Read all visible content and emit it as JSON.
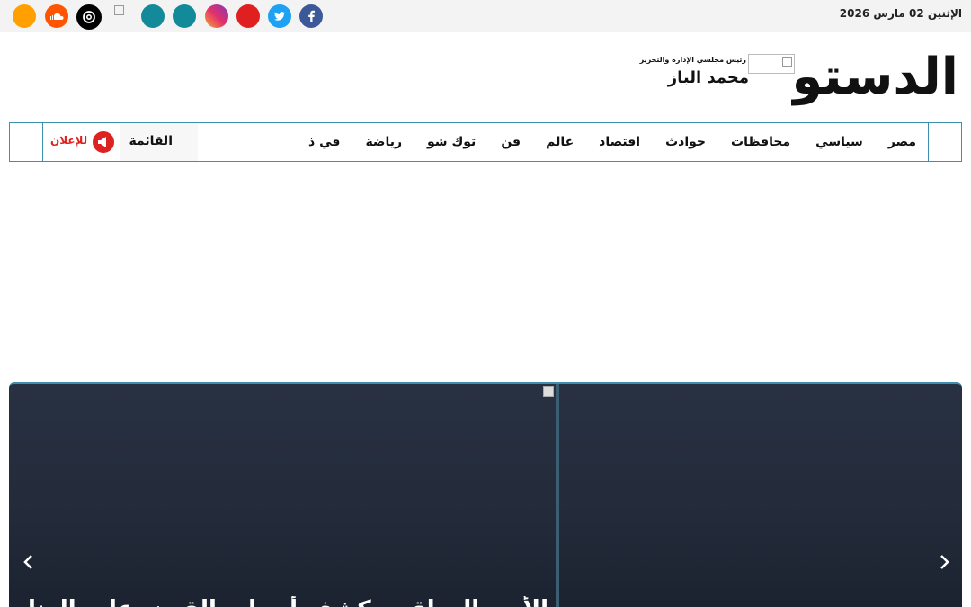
{
  "topbar": {
    "date": "الإثنين 02 مارس 2026",
    "social": [
      {
        "name": "facebook-icon",
        "color": "#3b5998"
      },
      {
        "name": "twitter-icon",
        "color": "#1da1f2"
      },
      {
        "name": "youtube-icon",
        "color": "#e02020"
      },
      {
        "name": "instagram-icon",
        "color": "#c13584"
      },
      {
        "name": "teal-icon-1",
        "color": "#138a99"
      },
      {
        "name": "teal-icon-2",
        "color": "#138a99"
      },
      {
        "name": "threads-icon",
        "color": "#000000"
      },
      {
        "name": "soundcloud-icon",
        "color": "#ff5500"
      },
      {
        "name": "orange-icon",
        "color": "#ffa000"
      }
    ]
  },
  "header": {
    "logo_text": "الدستور",
    "editor_role": "رئيس مجلسي الإدارة والتحرير",
    "editor_name": "محمد الباز"
  },
  "nav": {
    "items": [
      "مصر",
      "سياسي",
      "محافظات",
      "حوادث",
      "اقتصاد",
      "عالم",
      "فن",
      "توك شو",
      "رياضة",
      "في ذ"
    ],
    "menu_label": "القائمة",
    "ad_label": "للإعلان"
  },
  "slider": {
    "headline": "الأمن العراقي يكشف أسباب القبض على العناصر والنقلة البرلمانية"
  },
  "colors": {
    "accent": "#3d8fb0",
    "slider_bg": "#262f3f",
    "logo": "#111111",
    "ad_red": "#dd2222"
  }
}
